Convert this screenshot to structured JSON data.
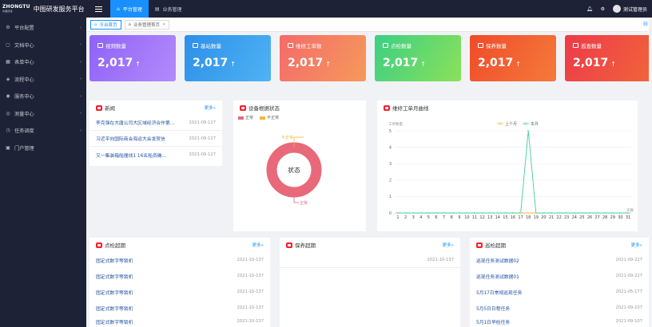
{
  "app": {
    "logo_text": "ZHONGTU",
    "logo_sub": "中图研发",
    "title": "中图研发服务平台"
  },
  "top_tabs": [
    {
      "label": "平台管理",
      "icon": "house-icon",
      "active": true
    },
    {
      "label": "业务管理",
      "icon": "document-icon",
      "active": false
    }
  ],
  "user": {
    "name": "测试管理员"
  },
  "sidebar": {
    "items": [
      {
        "label": "平台配置",
        "icon": "gear-icon"
      },
      {
        "label": "文档中心",
        "icon": "file-icon"
      },
      {
        "label": "表单中心",
        "icon": "form-icon"
      },
      {
        "label": "流程中心",
        "icon": "flow-icon"
      },
      {
        "label": "服务中心",
        "icon": "service-icon"
      },
      {
        "label": "测量中心",
        "icon": "measure-icon"
      },
      {
        "label": "任务调度",
        "icon": "task-icon"
      },
      {
        "label": "门户管理",
        "icon": "portal-icon"
      }
    ]
  },
  "page_tabs": [
    {
      "label": "平台首页",
      "active": true,
      "closable": false
    },
    {
      "label": "业务管理首页",
      "active": false,
      "closable": true
    }
  ],
  "stats": [
    {
      "label": "视频数量",
      "value": "2,017",
      "color_from": "#8e62f7",
      "color_to": "#b38bfb"
    },
    {
      "label": "基站数量",
      "value": "2,017",
      "color_from": "#2d8fe9",
      "color_to": "#4fb3f3"
    },
    {
      "label": "维修工单数",
      "value": "2,017",
      "color_from": "#f56a6a",
      "color_to": "#f59a5b"
    },
    {
      "label": "点检数量",
      "value": "2,017",
      "color_from": "#3ccf83",
      "color_to": "#8be15a"
    },
    {
      "label": "保养数量",
      "value": "2,017",
      "color_from": "#f04b2a",
      "color_to": "#f57a3a"
    },
    {
      "label": "巡查数量",
      "value": "2,017",
      "color_from": "#ee3a4a",
      "color_to": "#f0643a"
    }
  ],
  "news": {
    "title": "新闻",
    "more": "更多»",
    "rows": [
      {
        "text": "李克强在大唐公司大区域经济合作第...",
        "date": "2021-09-127"
      },
      {
        "text": "习近平向国际商会海运大会发贺信",
        "date": "2021-09-127"
      },
      {
        "text": "又一集装箱船撞线1 16名船员确...",
        "date": "2021-09-127"
      }
    ]
  },
  "status_panel": {
    "title": "设备根据状态",
    "legend": [
      "正常",
      "不正常"
    ],
    "center_label": "状态",
    "label_abnormal": "不正常",
    "label_normal": "正常"
  },
  "chart_data": {
    "type": "line",
    "title": "维修工单月曲线",
    "ylabel": "工单数量",
    "xlabel": "天数",
    "x": [
      1,
      2,
      3,
      4,
      5,
      6,
      7,
      8,
      9,
      10,
      11,
      12,
      13,
      14,
      15,
      16,
      17,
      18,
      19,
      20,
      21,
      22,
      23,
      24,
      25,
      26,
      27,
      28,
      29,
      30,
      31
    ],
    "ylim": [
      0,
      5
    ],
    "yticks": [
      0,
      1,
      2,
      3,
      4,
      5
    ],
    "series": [
      {
        "name": "上个月",
        "color": "#f5b731",
        "values": [
          0,
          0,
          0,
          0,
          0,
          0,
          0,
          0,
          0,
          0,
          0,
          0,
          0,
          0,
          0,
          0,
          0,
          0,
          0,
          0,
          0,
          0,
          0,
          0,
          0,
          0,
          0,
          0,
          0,
          0,
          0
        ]
      },
      {
        "name": "本月",
        "color": "#3fcf9c",
        "values": [
          0,
          0,
          0,
          0,
          0,
          0,
          0,
          0,
          0,
          0,
          0,
          0,
          0,
          0,
          0,
          0,
          0,
          5,
          0,
          0,
          0,
          0,
          0,
          0,
          0,
          0,
          0,
          0,
          0,
          0,
          0
        ]
      }
    ]
  },
  "inspect": {
    "title": "点检超期",
    "more": "更多»",
    "rows": [
      {
        "text": "固定式数字等锁机",
        "date": "2021-10-137"
      },
      {
        "text": "固定式数字等锁机",
        "date": "2021-10-137"
      },
      {
        "text": "固定式数字等锁机",
        "date": "2021-10-137"
      },
      {
        "text": "固定式数字等锁机",
        "date": "2021-10-137"
      },
      {
        "text": "固定式数字等锁机",
        "date": "2021-10-137"
      }
    ]
  },
  "maintain": {
    "title": "保养超期",
    "more": "更多»",
    "rows": [
      {
        "text": "",
        "date": "2021-10-137"
      }
    ]
  },
  "patrol": {
    "title": "巡检超期",
    "more": "更多»",
    "rows": [
      {
        "text": "巡现任务测试数据02",
        "date": "2021-09-227"
      },
      {
        "text": "巡现任务测试数据01",
        "date": "2021-09-227"
      },
      {
        "text": "5月17日常规巡现任务",
        "date": "2021-05-177"
      },
      {
        "text": "5月5日日程任务",
        "date": "2021-09-107"
      },
      {
        "text": "5月1日早检任务",
        "date": "2021-09-107"
      }
    ]
  }
}
